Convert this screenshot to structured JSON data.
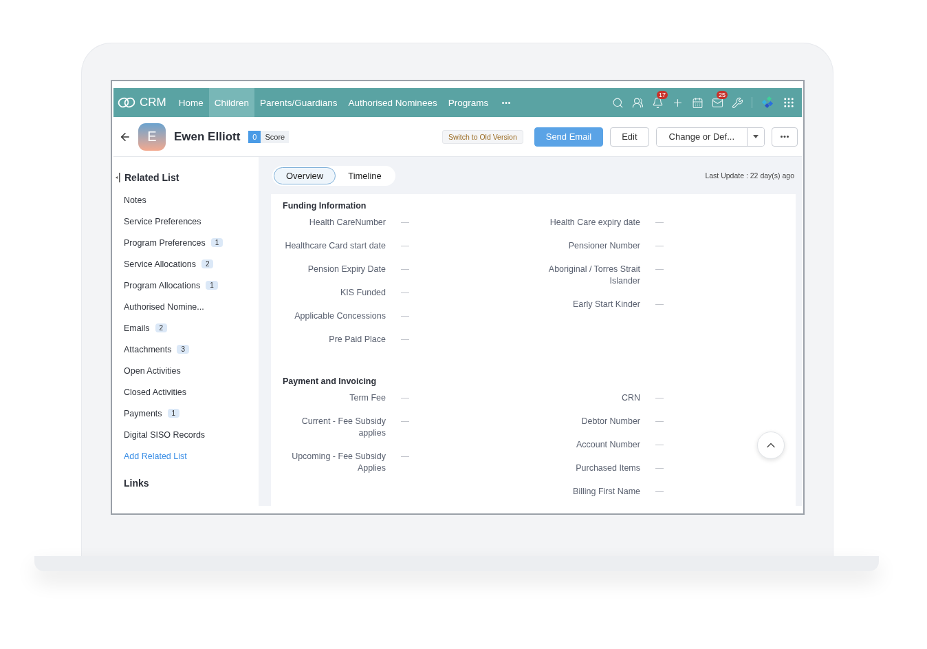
{
  "nav": {
    "brand": "CRM",
    "items": [
      {
        "label": "Home",
        "selected": false
      },
      {
        "label": "Children",
        "selected": true
      },
      {
        "label": "Parents/Guardians",
        "selected": false
      },
      {
        "label": "Authorised Nominees",
        "selected": false
      },
      {
        "label": "Programs",
        "selected": false
      }
    ],
    "tools": [
      {
        "kind": "search"
      },
      {
        "kind": "contacts"
      },
      {
        "kind": "bell",
        "badge": "17"
      },
      {
        "kind": "plus"
      },
      {
        "kind": "calendar"
      },
      {
        "kind": "mail",
        "badge": "25"
      },
      {
        "kind": "tools"
      },
      {
        "kind": "divider"
      },
      {
        "kind": "logo"
      },
      {
        "kind": "apps"
      }
    ]
  },
  "record": {
    "avatar": "E",
    "name": "Ewen Elliott",
    "score": "0",
    "score_label": "Score",
    "switch_label": "Switch to Old Version",
    "buttons": [
      {
        "label": "Send Email",
        "kind": "primary"
      },
      {
        "label": "Edit",
        "kind": "plain"
      },
      {
        "label": "Change or Def...",
        "kind": "split"
      },
      {
        "kind": "more"
      }
    ]
  },
  "sidebar": {
    "title": "Related List",
    "items": [
      {
        "label": "Notes",
        "kind": "item"
      },
      {
        "label": "Service Preferences",
        "kind": "item"
      },
      {
        "label": "Program Preferences",
        "count": "1",
        "kind": "item"
      },
      {
        "label": "Service Allocations",
        "count": "2",
        "kind": "item"
      },
      {
        "label": "Program Allocations",
        "count": "1",
        "kind": "item"
      },
      {
        "label": "Authorised Nomine...",
        "kind": "item"
      },
      {
        "label": "Emails",
        "count": "2",
        "kind": "item"
      },
      {
        "label": "Attachments",
        "count": "3",
        "kind": "item"
      },
      {
        "label": "Open Activities",
        "kind": "item"
      },
      {
        "label": "Closed Activities",
        "kind": "item"
      },
      {
        "label": "Payments",
        "count": "1",
        "kind": "item"
      },
      {
        "label": "Digital SISO Records",
        "kind": "item"
      },
      {
        "label": "Add Related List",
        "kind": "link"
      }
    ],
    "links_title": "Links"
  },
  "tabs": [
    {
      "label": "Overview",
      "selected": true
    },
    {
      "label": "Timeline",
      "selected": false
    }
  ],
  "last_update": "Last Update : 22 day(s) ago",
  "sections": [
    {
      "title": "Funding Information",
      "left": [
        {
          "label": "Health CareNumber",
          "value": "—"
        },
        {
          "label": "Healthcare Card start date",
          "value": "—"
        },
        {
          "label": "Pension Expiry Date",
          "value": "—"
        },
        {
          "label": "KIS Funded",
          "value": "—"
        },
        {
          "label": "Applicable Concessions",
          "value": "—"
        },
        {
          "label": "Pre Paid Place",
          "value": "—"
        }
      ],
      "right": [
        {
          "label": "Health Care expiry date",
          "value": "—"
        },
        {
          "label": "Pensioner Number",
          "value": "—"
        },
        {
          "label": "Aboriginal / Torres Strait Islander",
          "value": "—"
        },
        {
          "label": "Early Start Kinder",
          "value": "—"
        }
      ]
    },
    {
      "title": "Payment and Invoicing",
      "left": [
        {
          "label": "Term Fee",
          "value": "—"
        },
        {
          "label": "Current - Fee Subsidy applies",
          "value": "—"
        },
        {
          "label": "Upcoming - Fee Subsidy Applies",
          "value": "—"
        }
      ],
      "right": [
        {
          "label": "CRN",
          "value": "—"
        },
        {
          "label": "Debtor Number",
          "value": "—"
        },
        {
          "label": "Account Number",
          "value": "—"
        },
        {
          "label": "Purchased Items",
          "value": "—"
        },
        {
          "label": "Billing First Name",
          "value": "—"
        }
      ]
    }
  ]
}
